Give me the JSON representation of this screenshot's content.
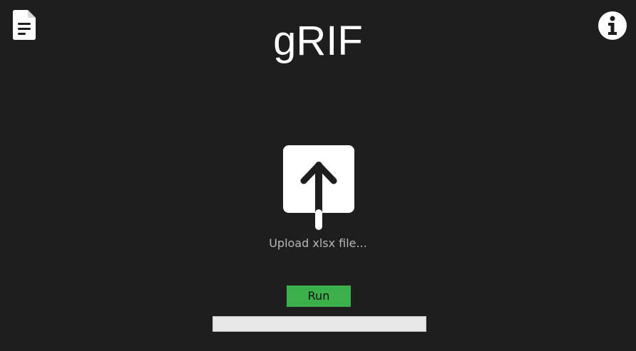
{
  "header": {
    "title": "gRIF",
    "left_icon": "document-icon",
    "right_icon": "info-icon"
  },
  "upload": {
    "icon": "upload-arrow-icon",
    "label": "Upload xlsx file..."
  },
  "run": {
    "label": "Run"
  },
  "progress": {
    "value": 0
  },
  "colors": {
    "background": "#1e1e1e",
    "title_text": "#ffffff",
    "label_text": "#b8b8b8",
    "run_button": "#3cb04a",
    "progress_track": "#e8e8e8",
    "icon_fill": "#ffffff"
  }
}
